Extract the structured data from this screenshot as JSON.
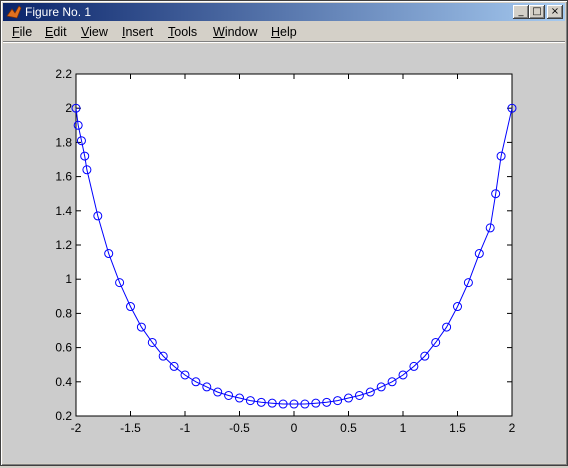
{
  "window": {
    "title": "Figure No. 1",
    "minimize_glyph": "_",
    "maximize_glyph": "□",
    "close_glyph": "×"
  },
  "menu": [
    {
      "label": "File",
      "key": "F",
      "rest": "ile"
    },
    {
      "label": "Edit",
      "key": "E",
      "rest": "dit"
    },
    {
      "label": "View",
      "key": "V",
      "rest": "iew"
    },
    {
      "label": "Insert",
      "key": "I",
      "rest": "nsert"
    },
    {
      "label": "Tools",
      "key": "T",
      "rest": "ools"
    },
    {
      "label": "Window",
      "key": "W",
      "rest": "indow"
    },
    {
      "label": "Help",
      "key": "H",
      "rest": "elp"
    }
  ],
  "colors": {
    "line": "#0000ff",
    "axes_bg": "#ffffff",
    "figure_bg": "#cccccc"
  },
  "chart_data": {
    "type": "line",
    "marker": "circle",
    "xlim": [
      -2,
      2
    ],
    "ylim": [
      0.2,
      2.2
    ],
    "xticks": [
      "-2",
      "-1.5",
      "-1",
      "-0.5",
      "0",
      "0.5",
      "1",
      "1.5",
      "2"
    ],
    "yticks": [
      "0.2",
      "0.4",
      "0.6",
      "0.8",
      "1",
      "1.2",
      "1.4",
      "1.6",
      "1.8",
      "2",
      "2.2"
    ],
    "x": [
      -2.0,
      -1.98,
      -1.95,
      -1.92,
      -1.9,
      -1.8,
      -1.7,
      -1.6,
      -1.5,
      -1.4,
      -1.3,
      -1.2,
      -1.1,
      -1.0,
      -0.9,
      -0.8,
      -0.7,
      -0.6,
      -0.5,
      -0.4,
      -0.3,
      -0.2,
      -0.1,
      0.0,
      0.1,
      0.2,
      0.3,
      0.4,
      0.5,
      0.6,
      0.7,
      0.8,
      0.9,
      1.0,
      1.1,
      1.2,
      1.3,
      1.4,
      1.5,
      1.6,
      1.7,
      1.8,
      1.85,
      1.9,
      2.0
    ],
    "y": [
      2.0,
      1.9,
      1.81,
      1.72,
      1.64,
      1.37,
      1.15,
      0.98,
      0.84,
      0.72,
      0.63,
      0.55,
      0.49,
      0.44,
      0.4,
      0.37,
      0.34,
      0.32,
      0.305,
      0.29,
      0.28,
      0.275,
      0.27,
      0.27,
      0.27,
      0.275,
      0.28,
      0.29,
      0.305,
      0.32,
      0.34,
      0.37,
      0.4,
      0.44,
      0.49,
      0.55,
      0.63,
      0.72,
      0.84,
      0.98,
      1.15,
      1.3,
      1.5,
      1.72,
      2.0
    ]
  }
}
